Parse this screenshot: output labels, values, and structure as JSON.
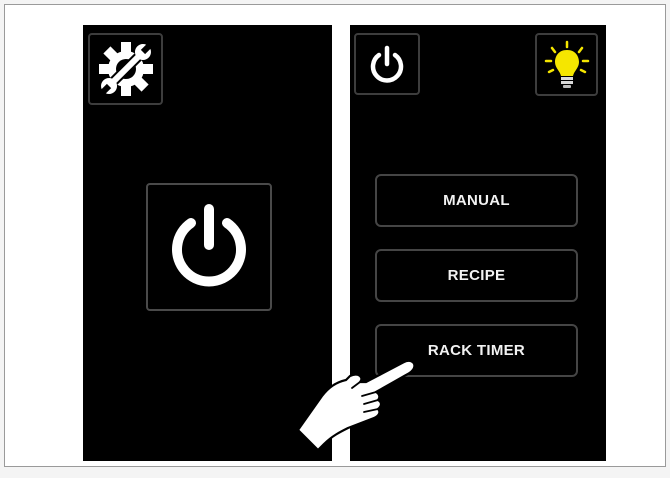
{
  "left_panel": {
    "settings_icon": "settings-gear-wrench-icon",
    "main_power_icon": "power-icon"
  },
  "right_panel": {
    "power_icon": "power-icon",
    "light_icon": "light-bulb-icon",
    "menu": {
      "manual_label": "MANUAL",
      "recipe_label": "RECIPE",
      "rack_timer_label": "RACK TIMER"
    }
  },
  "colors": {
    "screen_background": "#000000",
    "button_border": "#454545",
    "text": "#f2f2f2",
    "bulb": "#f5e600"
  }
}
